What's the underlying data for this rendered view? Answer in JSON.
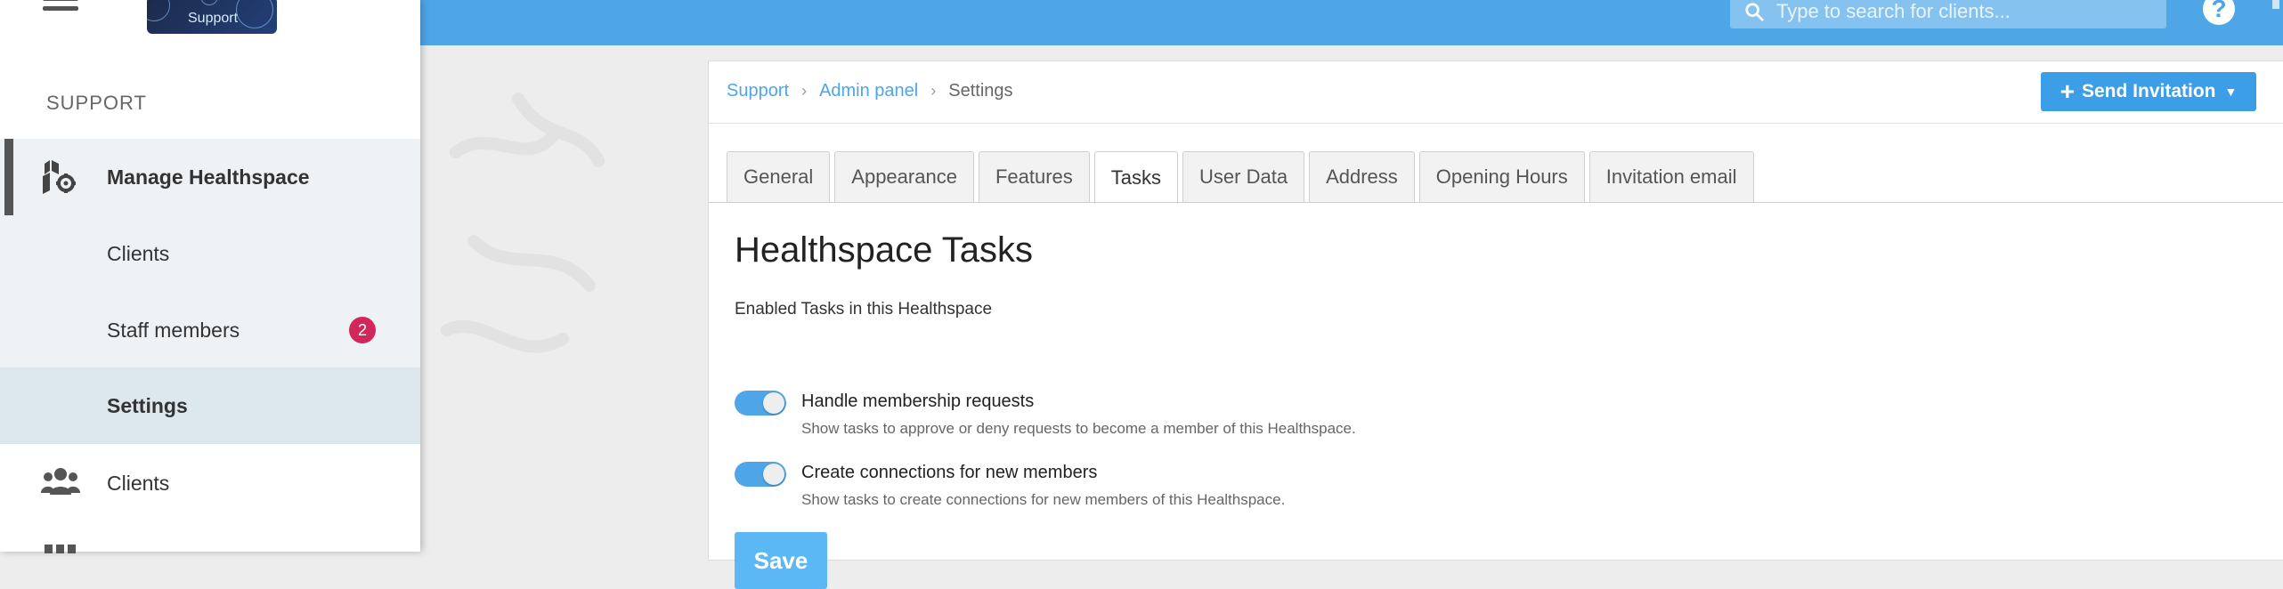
{
  "header": {
    "search_placeholder": "Type to search for clients...",
    "help_label": "?",
    "accent_color": "#4ea6e6"
  },
  "sidebar": {
    "logo_text": "Support",
    "section_label": "SUPPORT",
    "items": [
      {
        "label": "Manage Healthspace",
        "icon": "manage-healthspace-icon"
      },
      {
        "label": "Clients"
      },
      {
        "label": "Staff members",
        "badge": "2"
      },
      {
        "label": "Settings"
      },
      {
        "label": "Clients",
        "icon": "people-group-icon"
      }
    ]
  },
  "breadcrumb": {
    "items": [
      "Support",
      "Admin panel",
      "Settings"
    ]
  },
  "send_invitation_label": "Send Invitation",
  "tabs": [
    "General",
    "Appearance",
    "Features",
    "Tasks",
    "User Data",
    "Address",
    "Opening Hours",
    "Invitation email"
  ],
  "active_tab": "Tasks",
  "content": {
    "title": "Healthspace Tasks",
    "enabled_label": "Enabled Tasks in this Healthspace",
    "tasks": [
      {
        "label": "Handle membership requests",
        "description": "Show tasks to approve or deny requests to become a member of this Healthspace.",
        "enabled": true
      },
      {
        "label": "Create connections for new members",
        "description": "Show tasks to create connections for new members of this Healthspace.",
        "enabled": true
      }
    ],
    "save_label": "Save"
  }
}
